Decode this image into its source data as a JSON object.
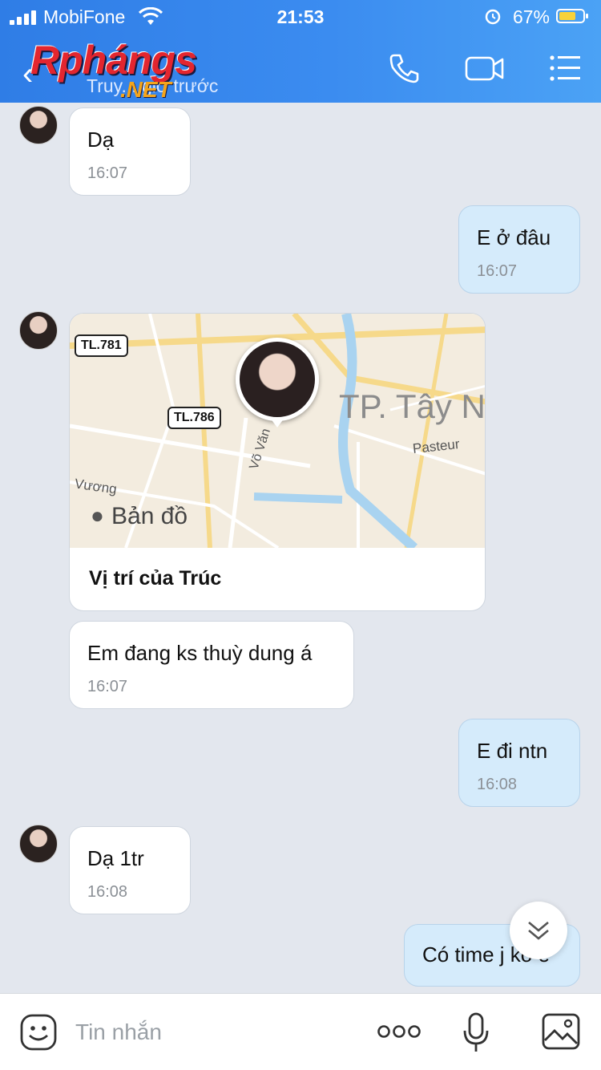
{
  "status_bar": {
    "carrier": "MobiFone",
    "time": "21:53",
    "battery": "67%"
  },
  "header": {
    "logo_main": "Rphángs",
    "logo_net": ".NET",
    "subtitle": "Truy... giờ trước"
  },
  "messages": [
    {
      "side": "in",
      "text": "Dạ",
      "time": "16:07"
    },
    {
      "side": "out",
      "text": "E ở đâu",
      "time": "16:07"
    },
    {
      "side": "in",
      "type": "location",
      "caption": "Vị trí của Trúc"
    },
    {
      "side": "in",
      "text": "Em đang ks thuỳ dung á",
      "time": "16:07"
    },
    {
      "side": "out",
      "text": "E đi ntn",
      "time": "16:08"
    },
    {
      "side": "in",
      "text": "Dạ 1tr",
      "time": "16:08"
    },
    {
      "side": "out",
      "text": "Có time j ko e",
      "time": ""
    }
  ],
  "map": {
    "road_1": "TL.781",
    "road_2": "TL.786",
    "city": "TP. Tây Ninh",
    "street_1": "Pasteur",
    "street_2": "Võ Văn",
    "street_3": "Vương",
    "attribution": "Bản đồ"
  },
  "input": {
    "placeholder": "Tin nhắn"
  },
  "colors": {
    "header": "#3b8cf0",
    "bubble_out": "#d5ebfb",
    "bubble_in": "#ffffff",
    "background": "#e3e7ee"
  },
  "icons": [
    "phone-icon",
    "video-icon",
    "menu-icon",
    "emoji-icon",
    "more-icon",
    "mic-icon",
    "image-icon",
    "chevron-double-down-icon"
  ]
}
